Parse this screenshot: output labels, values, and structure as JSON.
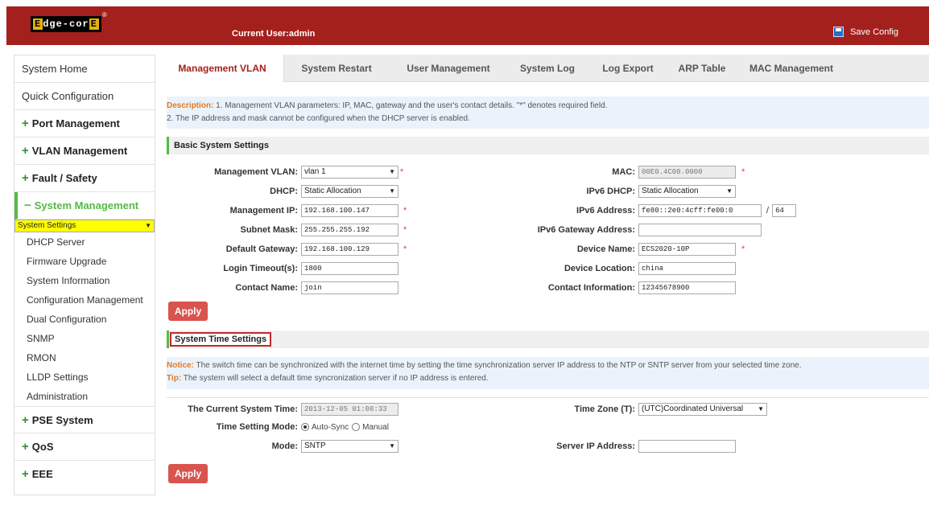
{
  "header": {
    "logo_text": "Edge-corE",
    "current_user": "Current User:admin",
    "save_config": "Save Config"
  },
  "sidebar": {
    "items": [
      {
        "label": "System Home"
      },
      {
        "label": "Quick Configuration"
      },
      {
        "label": "Port Management",
        "prefix": "+"
      },
      {
        "label": "VLAN Management",
        "prefix": "+"
      },
      {
        "label": "Fault / Safety",
        "prefix": "+"
      },
      {
        "label": "System Management",
        "prefix": "−"
      },
      {
        "label": "PSE System",
        "prefix": "+"
      },
      {
        "label": "QoS",
        "prefix": "+"
      },
      {
        "label": "EEE",
        "prefix": "+"
      }
    ],
    "sub_items": [
      "System Settings",
      "DHCP Server",
      "Firmware Upgrade",
      "System Information",
      "Configuration Management",
      "Dual Configuration",
      "SNMP",
      "RMON",
      "LLDP Settings",
      "Administration"
    ]
  },
  "tabs": [
    "Management VLAN",
    "System Restart",
    "User Management",
    "System Log",
    "Log Export",
    "ARP Table",
    "MAC Management"
  ],
  "description": {
    "label": "Description:",
    "line1": " 1. Management VLAN parameters: IP, MAC, gateway and the user's contact details. \"*\" denotes required field.",
    "line2": "2. The IP address and mask cannot be configured when the DHCP server is enabled."
  },
  "basic": {
    "title": "Basic System Settings",
    "mgmt_vlan_label": "Management VLAN:",
    "mgmt_vlan_value": "vlan 1",
    "dhcp_label": "DHCP:",
    "dhcp_value": "Static Allocation",
    "mgmt_ip_label": "Management IP:",
    "mgmt_ip_value": "192.168.100.147",
    "subnet_label": "Subnet Mask:",
    "subnet_value": "255.255.255.192",
    "gateway_label": "Default Gateway:",
    "gateway_value": "192.168.100.129",
    "timeout_label": "Login Timeout(s):",
    "timeout_value": "1800",
    "contact_label": "Contact Name:",
    "contact_value": "join",
    "mac_label": "MAC:",
    "mac_value": "00E0.4C00.0000",
    "ipv6_dhcp_label": "IPv6 DHCP:",
    "ipv6_dhcp_value": "Static Allocation",
    "ipv6_addr_label": "IPv6 Address:",
    "ipv6_addr_value": "fe80::2e0:4cff:fe00:0",
    "ipv6_prefix_sep": "/",
    "ipv6_prefix_value": "64",
    "ipv6_gw_label": "IPv6 Gateway Address:",
    "ipv6_gw_value": "",
    "device_name_label": "Device Name:",
    "device_name_value": "ECS2020-10P",
    "device_loc_label": "Device Location:",
    "device_loc_value": "china",
    "contact_info_label": "Contact Information:",
    "contact_info_value": "12345678900",
    "required_mark": "*",
    "apply": "Apply"
  },
  "time": {
    "title": "System Time Settings",
    "notice_label": "Notice:",
    "notice_text": " The switch time can be synchronized with the internet time by setting the time synchronization server IP address to the NTP or SNTP server from your selected time zone.",
    "tip_label": "Tip:",
    "tip_text": " The system will select a default time syncronization server if no IP address is entered.",
    "current_time_label": "The Current System Time:",
    "current_time_value": "2013-12-05 01:08:33",
    "setting_mode_label": "Time Setting Mode:",
    "auto_sync": "Auto-Sync",
    "manual": "Manual",
    "mode_label": "Mode:",
    "mode_value": "SNTP",
    "timezone_label": "Time Zone (T):",
    "timezone_value": "(UTC)Coordinated Universal",
    "server_ip_label": "Server IP Address:",
    "server_ip_value": "",
    "apply": "Apply"
  }
}
